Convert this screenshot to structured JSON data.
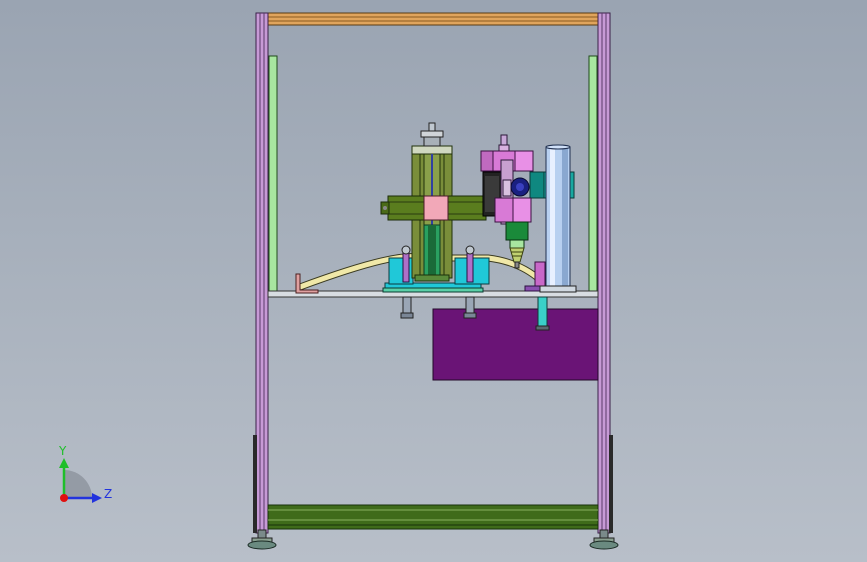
{
  "axes": {
    "y_label": "Y",
    "z_label": "Z",
    "colors": {
      "y": "#1fbf2a",
      "z": "#2233dd",
      "origin": "#e01010"
    }
  },
  "colors": {
    "background": "#a3acb8",
    "frame_profile": "#c79ad6",
    "top_bar": "#e0a45c",
    "inner_post": "#a8e6a0",
    "base_rail": "#3f6b1a",
    "table_plate": "#d8dde2",
    "control_box": "#6a1476",
    "cylinder_body": "#5a7d1e",
    "cylinder_block": "#f2a8b8",
    "vertical_column": "#7a8e3a",
    "clamp_cyan": "#20c8d8",
    "motor_pink": "#d87ad6",
    "motor_dark": "#222222",
    "nozzle_green": "#1a8a3a",
    "nozzle_teal": "#18a8a0",
    "tube_blue": "#b8d0f0",
    "hose_yellow": "#f0e8a8",
    "foot_pad": "#6a8a80"
  }
}
